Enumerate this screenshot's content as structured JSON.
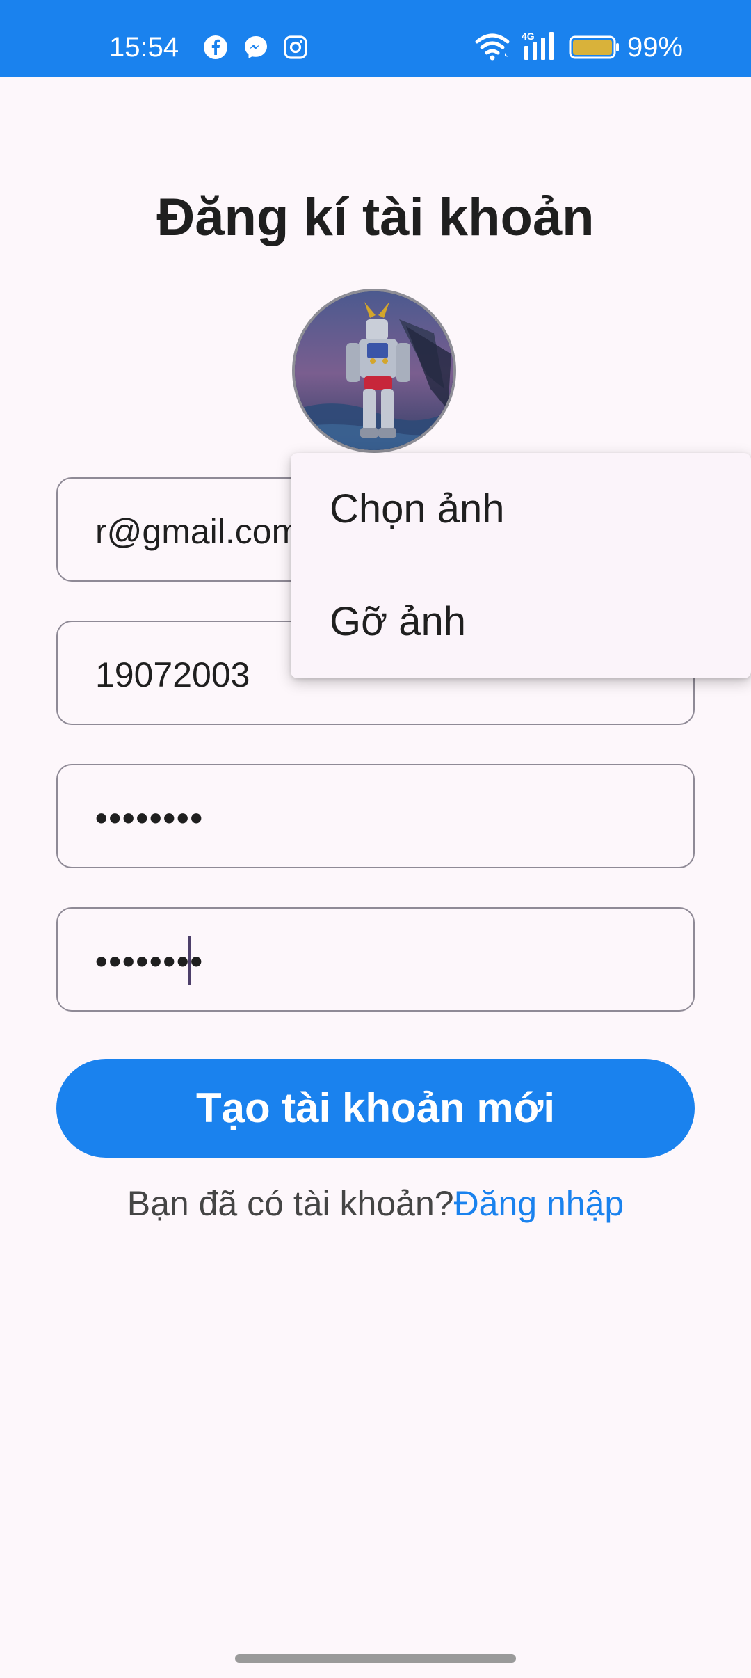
{
  "status_bar": {
    "time": "15:54",
    "battery": "99%",
    "network": "4G",
    "app_icons": [
      "facebook-icon",
      "messenger-icon",
      "instagram-icon"
    ],
    "color": "#1a82ee"
  },
  "page": {
    "title": "Đăng kí tài khoản"
  },
  "form": {
    "email_value": "r@gmail.com",
    "birthday_value": "19072003",
    "password_value": "••••••••",
    "confirm_password_value": "••••••••"
  },
  "menu": {
    "items": [
      "Chọn ảnh",
      "Gỡ ảnh"
    ]
  },
  "actions": {
    "create_button": "Tạo tài khoản mới",
    "have_account_text": "Bạn đã có tài khoản?",
    "login_link": "Đăng nhập"
  },
  "colors": {
    "accent": "#1a82ee",
    "background": "#fdf7fb"
  }
}
